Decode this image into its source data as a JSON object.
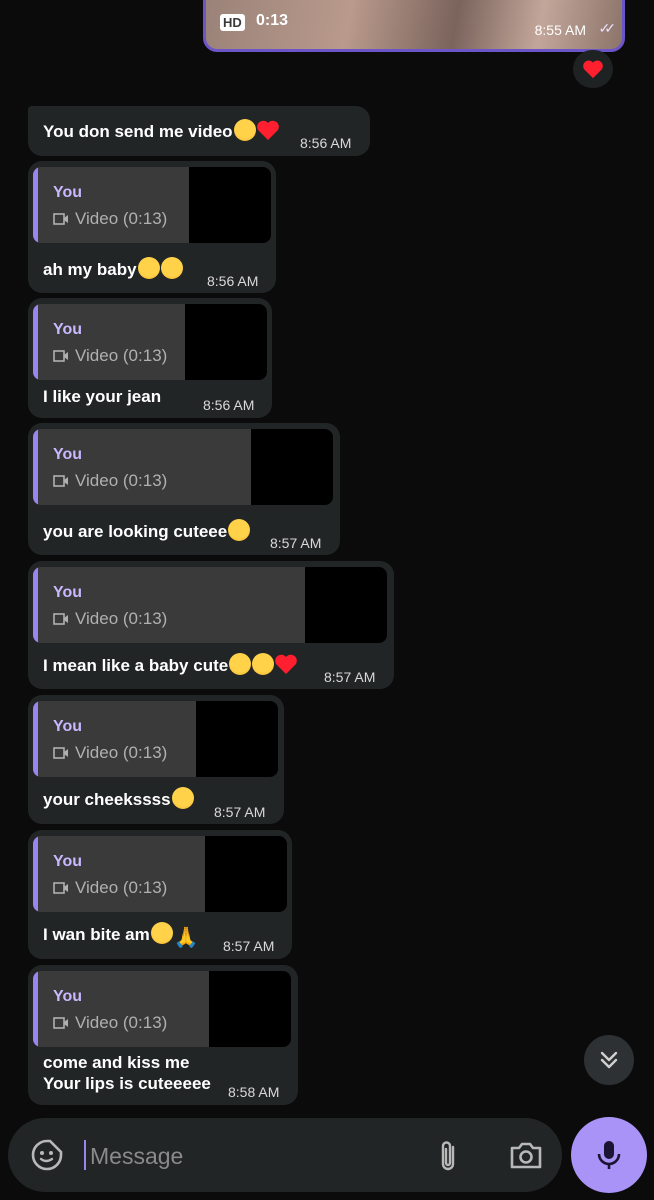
{
  "top_video": {
    "hd_label": "HD",
    "duration": "0:13",
    "time": "8:55 AM",
    "reaction": "❤️"
  },
  "messages": [
    {
      "text": "You don send me video",
      "emojis": [
        "cry",
        "heart"
      ],
      "time": "8:56 AM"
    },
    {
      "reply_author": "You",
      "reply_text": "Video (0:13)",
      "text": "ah my baby",
      "emojis": [
        "plead",
        "shush"
      ],
      "time": "8:56 AM"
    },
    {
      "reply_author": "You",
      "reply_text": "Video (0:13)",
      "text": "I like your jean",
      "time": "8:56 AM"
    },
    {
      "reply_author": "You",
      "reply_text": "Video (0:13)",
      "text": "you are looking cuteee",
      "emojis": [
        "cry"
      ],
      "time": "8:57 AM"
    },
    {
      "reply_author": "You",
      "reply_text": "Video (0:13)",
      "text": "I mean like a baby cute",
      "emojis": [
        "cry",
        "laugh",
        "heart"
      ],
      "time": "8:57 AM"
    },
    {
      "reply_author": "You",
      "reply_text": "Video (0:13)",
      "text": "your cheekssss",
      "emojis": [
        "cry"
      ],
      "time": "8:57 AM"
    },
    {
      "reply_author": "You",
      "reply_text": "Video (0:13)",
      "text": "I wan bite am",
      "emojis": [
        "cry",
        "pray"
      ],
      "time": "8:57 AM"
    },
    {
      "reply_author": "You",
      "reply_text": "Video (0:13)",
      "text_line1": "come and kiss me",
      "text_line2": "Your lips is cuteeeee",
      "time": "8:58 AM"
    }
  ],
  "composer": {
    "placeholder": "Message"
  },
  "colors": {
    "accent": "#a993f7",
    "bubble": "#222526",
    "reply_bar": "#9a85f0",
    "background": "#0b0b0b"
  }
}
